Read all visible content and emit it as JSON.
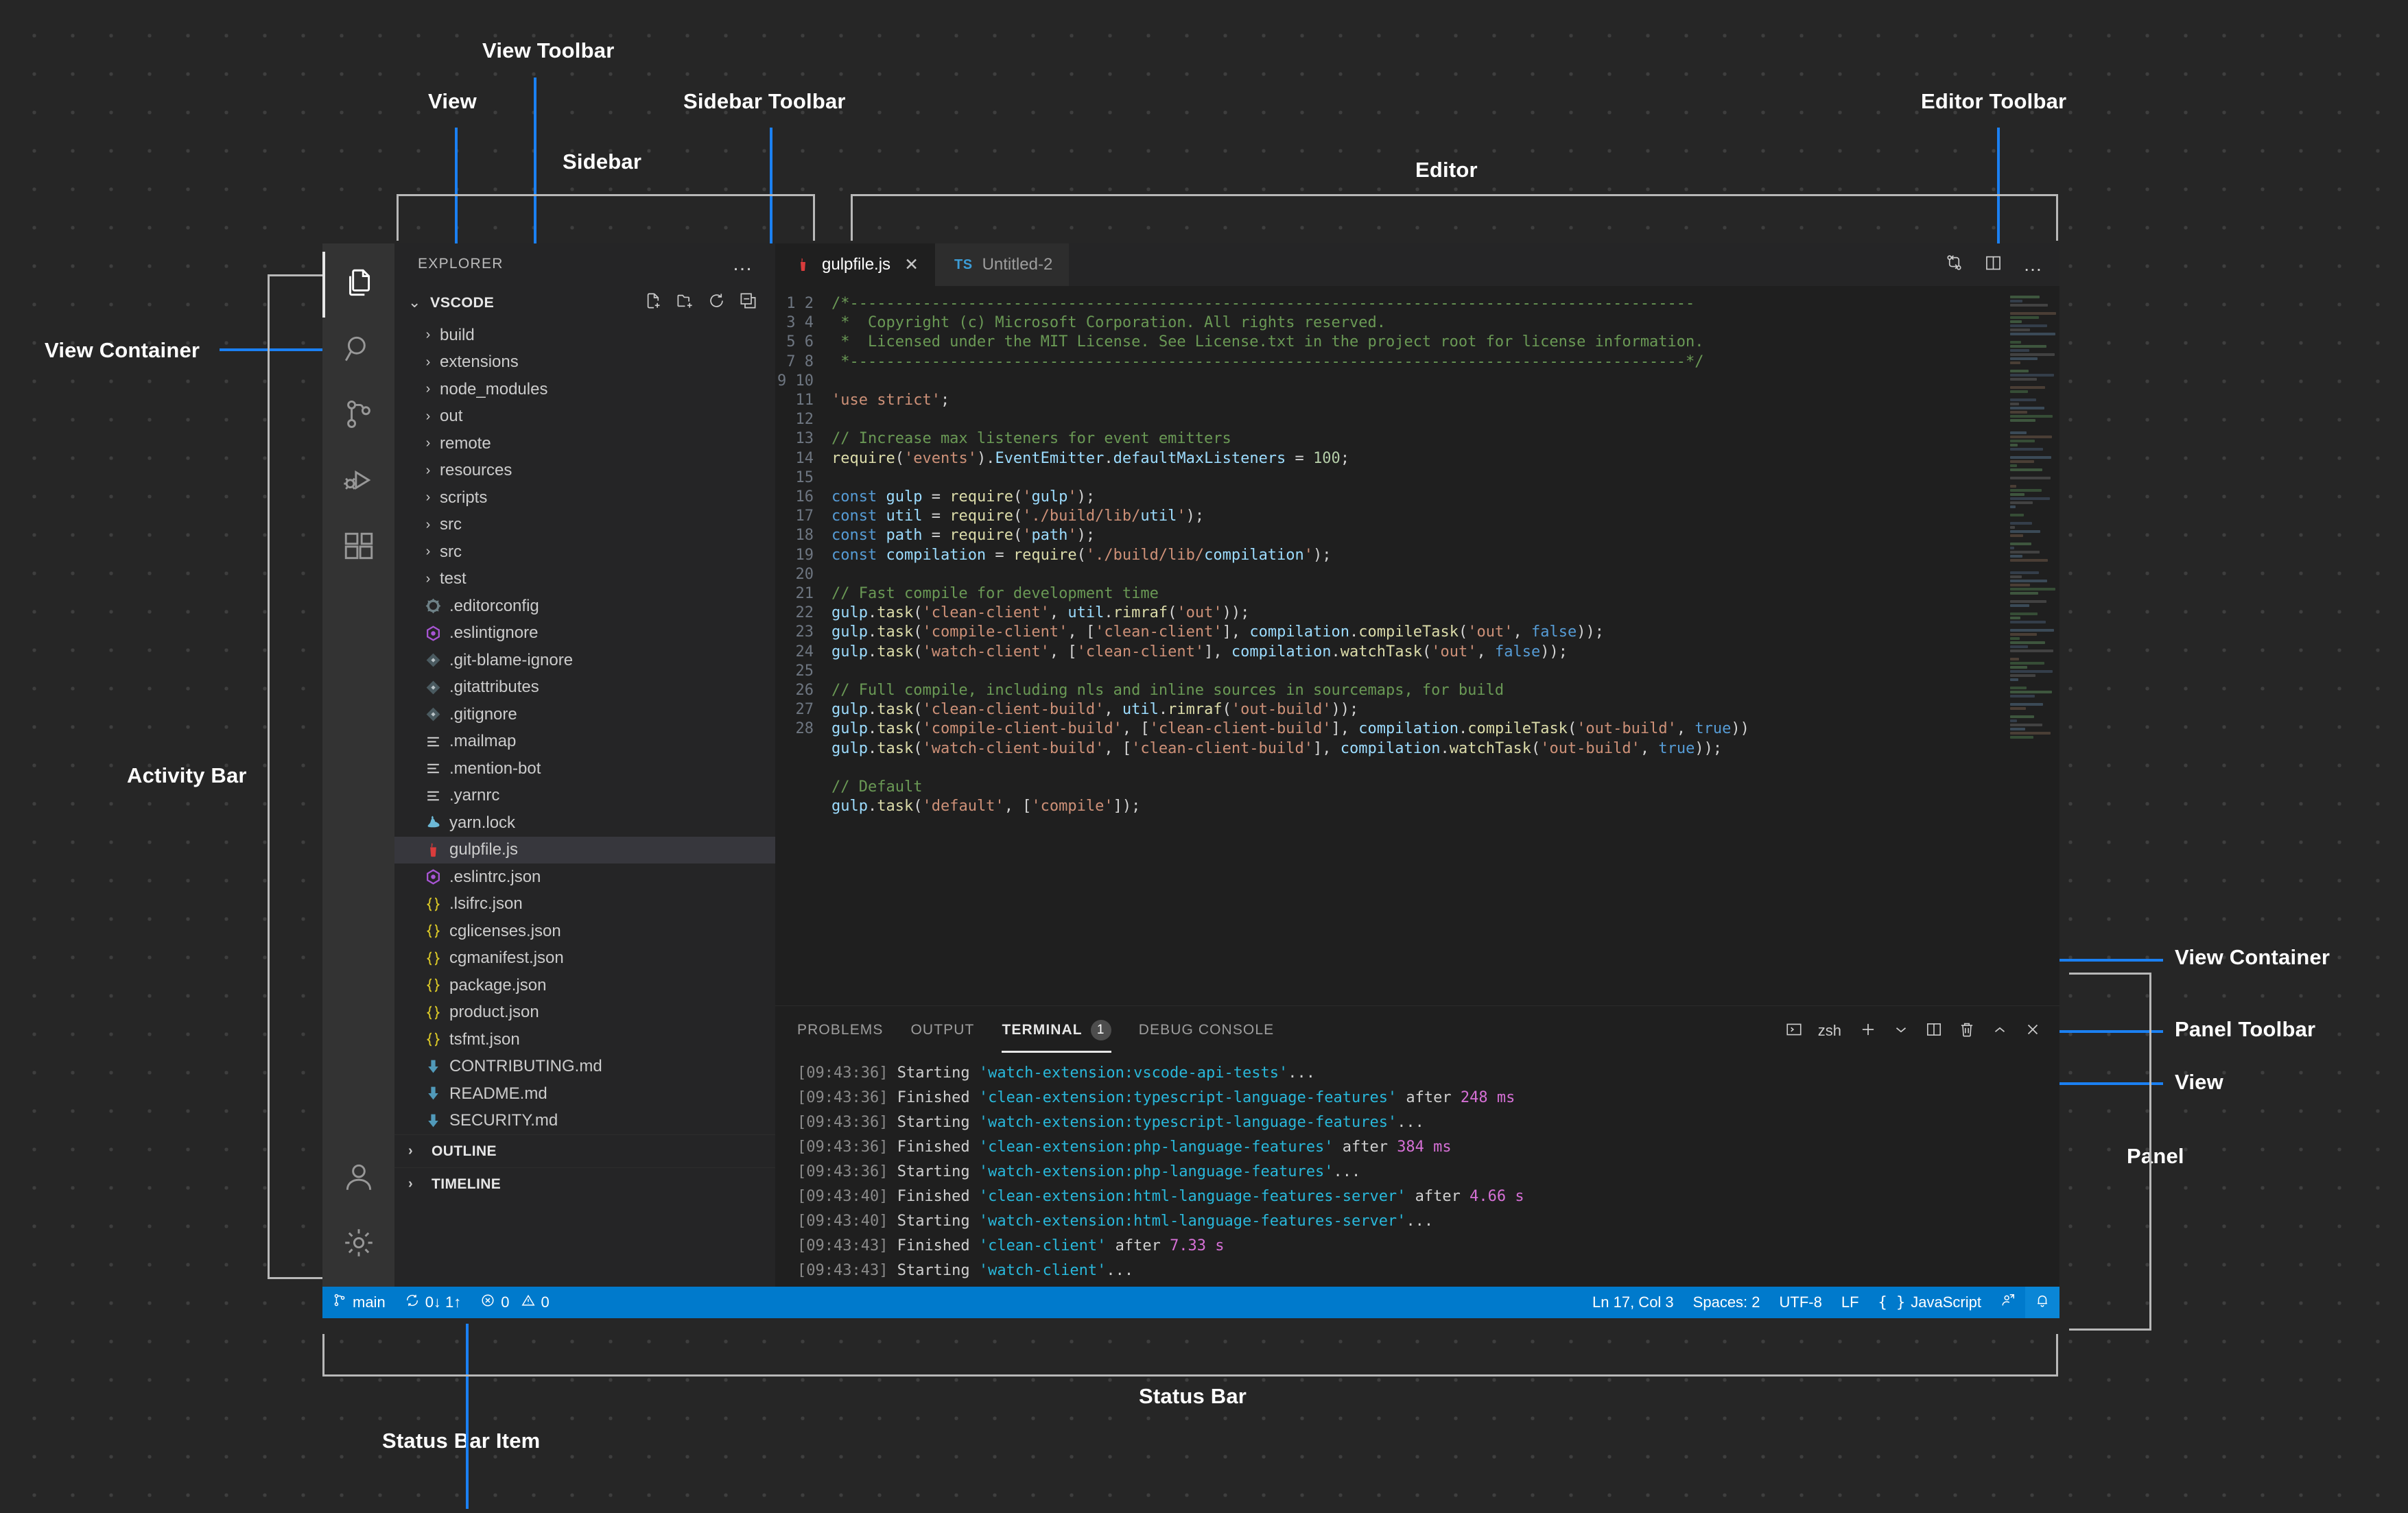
{
  "annotations": [
    {
      "key": "view_toolbar",
      "label": "View Toolbar"
    },
    {
      "key": "view_top",
      "label": "View"
    },
    {
      "key": "sidebar_toolbar",
      "label": "Sidebar Toolbar"
    },
    {
      "key": "sidebar",
      "label": "Sidebar"
    },
    {
      "key": "editor",
      "label": "Editor"
    },
    {
      "key": "editor_toolbar",
      "label": "Editor Toolbar"
    },
    {
      "key": "view_container_left",
      "label": "View Container"
    },
    {
      "key": "activity_bar",
      "label": "Activity Bar"
    },
    {
      "key": "view_container_right",
      "label": "View Container"
    },
    {
      "key": "panel_toolbar",
      "label": "Panel Toolbar"
    },
    {
      "key": "view_right",
      "label": "View"
    },
    {
      "key": "panel",
      "label": "Panel"
    },
    {
      "key": "status_bar",
      "label": "Status Bar"
    },
    {
      "key": "status_bar_item",
      "label": "Status Bar Item"
    }
  ],
  "activity_bar": {
    "items": [
      {
        "icon": "files-icon",
        "label": "Explorer",
        "active": true
      },
      {
        "icon": "search-icon",
        "label": "Search",
        "active": false
      },
      {
        "icon": "source-control-icon",
        "label": "Source Control",
        "active": false
      },
      {
        "icon": "run-debug-icon",
        "label": "Run and Debug",
        "active": false
      },
      {
        "icon": "extensions-icon",
        "label": "Extensions",
        "active": false
      }
    ],
    "bottom": [
      {
        "icon": "account-icon",
        "label": "Accounts"
      },
      {
        "icon": "gear-icon",
        "label": "Manage"
      }
    ]
  },
  "sidebar": {
    "title": "EXPLORER",
    "more_actions": "…",
    "view": {
      "twisty": "⌄",
      "title": "VSCODE",
      "toolbar": [
        {
          "icon": "new-file-icon",
          "label": "New File"
        },
        {
          "icon": "new-folder-icon",
          "label": "New Folder"
        },
        {
          "icon": "refresh-icon",
          "label": "Refresh Explorer"
        },
        {
          "icon": "collapse-all-icon",
          "label": "Collapse Folders in Explorer"
        }
      ]
    },
    "tree": [
      {
        "name": "build",
        "type": "folder",
        "icon": "folder-icon"
      },
      {
        "name": "extensions",
        "type": "folder",
        "icon": "folder-icon"
      },
      {
        "name": "node_modules",
        "type": "folder",
        "icon": "folder-icon"
      },
      {
        "name": "out",
        "type": "folder",
        "icon": "folder-icon"
      },
      {
        "name": "remote",
        "type": "folder",
        "icon": "folder-icon"
      },
      {
        "name": "resources",
        "type": "folder",
        "icon": "folder-icon"
      },
      {
        "name": "scripts",
        "type": "folder",
        "icon": "folder-icon"
      },
      {
        "name": "src",
        "type": "folder",
        "icon": "folder-icon"
      },
      {
        "name": "src",
        "type": "folder",
        "icon": "folder-icon"
      },
      {
        "name": "test",
        "type": "folder",
        "icon": "folder-icon"
      },
      {
        "name": ".editorconfig",
        "type": "file",
        "icon": "gear-file-icon"
      },
      {
        "name": ".eslintignore",
        "type": "file",
        "icon": "eslint-icon"
      },
      {
        "name": ".git-blame-ignore",
        "type": "file",
        "icon": "git-icon"
      },
      {
        "name": ".gitattributes",
        "type": "file",
        "icon": "git-icon"
      },
      {
        "name": ".gitignore",
        "type": "file",
        "icon": "git-icon"
      },
      {
        "name": ".mailmap",
        "type": "file",
        "icon": "text-icon"
      },
      {
        "name": ".mention-bot",
        "type": "file",
        "icon": "text-icon"
      },
      {
        "name": ".yarnrc",
        "type": "file",
        "icon": "text-icon"
      },
      {
        "name": "yarn.lock",
        "type": "file",
        "icon": "yarn-icon"
      },
      {
        "name": "gulpfile.js",
        "type": "file",
        "icon": "gulp-icon",
        "selected": true
      },
      {
        "name": ".eslintrc.json",
        "type": "file",
        "icon": "eslint-icon"
      },
      {
        "name": ".lsifrc.json",
        "type": "file",
        "icon": "json-icon"
      },
      {
        "name": "cglicenses.json",
        "type": "file",
        "icon": "json-icon"
      },
      {
        "name": "cgmanifest.json",
        "type": "file",
        "icon": "json-icon"
      },
      {
        "name": "package.json",
        "type": "file",
        "icon": "json-icon"
      },
      {
        "name": "product.json",
        "type": "file",
        "icon": "json-icon"
      },
      {
        "name": "tsfmt.json",
        "type": "file",
        "icon": "json-icon"
      },
      {
        "name": "CONTRIBUTING.md",
        "type": "file",
        "icon": "markdown-icon"
      },
      {
        "name": "README.md",
        "type": "file",
        "icon": "markdown-icon"
      },
      {
        "name": "SECURITY.md",
        "type": "file",
        "icon": "markdown-icon"
      }
    ],
    "collapsed_sections": [
      {
        "twisty": "›",
        "label": "OUTLINE"
      },
      {
        "twisty": "›",
        "label": "TIMELINE"
      }
    ]
  },
  "editor": {
    "tabs": [
      {
        "label": "gulpfile.js",
        "icon": "gulp-icon",
        "active": true,
        "close": "✕"
      },
      {
        "label": "Untitled-2",
        "icon": "ts-icon",
        "badge": "TS",
        "active": false
      }
    ],
    "toolbar": [
      {
        "icon": "run-task-icon",
        "label": "Run Task"
      },
      {
        "icon": "split-editor-icon",
        "label": "Split Editor Right"
      },
      {
        "icon": "more-actions-icon",
        "label": "More Actions...",
        "glyph": "…"
      }
    ],
    "first_line_number": 1,
    "last_line_number": 28,
    "code_lines": [
      "/*---------------------------------------------------------------------------------------------",
      " *  Copyright (c) Microsoft Corporation. All rights reserved.",
      " *  Licensed under the MIT License. See License.txt in the project root for license information.",
      " *--------------------------------------------------------------------------------------------*/",
      "",
      "'use strict';",
      "",
      "// Increase max listeners for event emitters",
      "require('events').EventEmitter.defaultMaxListeners = 100;",
      "",
      "const gulp = require('gulp');",
      "const util = require('./build/lib/util');",
      "const path = require('path');",
      "const compilation = require('./build/lib/compilation');",
      "",
      "// Fast compile for development time",
      "gulp.task('clean-client', util.rimraf('out'));",
      "gulp.task('compile-client', ['clean-client'], compilation.compileTask('out', false));",
      "gulp.task('watch-client', ['clean-client'], compilation.watchTask('out', false));",
      "",
      "// Full compile, including nls and inline sources in sourcemaps, for build",
      "gulp.task('clean-client-build', util.rimraf('out-build'));",
      "gulp.task('compile-client-build', ['clean-client-build'], compilation.compileTask('out-build', true))",
      "gulp.task('watch-client-build', ['clean-client-build'], compilation.watchTask('out-build', true));",
      "",
      "// Default",
      "gulp.task('default', ['compile']);",
      ""
    ]
  },
  "panel": {
    "tabs": [
      {
        "label": "PROBLEMS",
        "active": false
      },
      {
        "label": "OUTPUT",
        "active": false
      },
      {
        "label": "TERMINAL",
        "active": true,
        "count": "1"
      },
      {
        "label": "DEBUG CONSOLE",
        "active": false
      }
    ],
    "toolbar": {
      "shell_icon": "terminal-icon",
      "shell_name": "zsh",
      "buttons": [
        {
          "icon": "new-terminal-icon",
          "label": "New Terminal",
          "glyph": "+"
        },
        {
          "icon": "chevron-down-icon",
          "label": "Launch Profile",
          "glyph": "⌄"
        },
        {
          "icon": "split-terminal-icon",
          "label": "Split Terminal"
        },
        {
          "icon": "trash-icon",
          "label": "Kill Terminal"
        },
        {
          "icon": "chevron-up-icon",
          "label": "Maximize Panel Size",
          "glyph": "^"
        },
        {
          "icon": "close-icon",
          "label": "Close Panel",
          "glyph": "✕"
        }
      ]
    },
    "terminal_lines": [
      {
        "time": "[09:43:36]",
        "verb": " Starting ",
        "task": "'watch-extension:vscode-api-tests'",
        "tail": "..."
      },
      {
        "time": "[09:43:36]",
        "verb": " Finished ",
        "task": "'clean-extension:typescript-language-features'",
        "tail": " after ",
        "dur": "248 ms"
      },
      {
        "time": "[09:43:36]",
        "verb": " Starting ",
        "task": "'watch-extension:typescript-language-features'",
        "tail": "..."
      },
      {
        "time": "[09:43:36]",
        "verb": " Finished ",
        "task": "'clean-extension:php-language-features'",
        "tail": " after ",
        "dur": "384 ms"
      },
      {
        "time": "[09:43:36]",
        "verb": " Starting ",
        "task": "'watch-extension:php-language-features'",
        "tail": "..."
      },
      {
        "time": "[09:43:40]",
        "verb": " Finished ",
        "task": "'clean-extension:html-language-features-server'",
        "tail": " after ",
        "dur": "4.66 s"
      },
      {
        "time": "[09:43:40]",
        "verb": " Starting ",
        "task": "'watch-extension:html-language-features-server'",
        "tail": "..."
      },
      {
        "time": "[09:43:43]",
        "verb": " Finished ",
        "task": "'clean-client'",
        "tail": " after ",
        "dur": "7.33 s"
      },
      {
        "time": "[09:43:43]",
        "verb": " Starting ",
        "task": "'watch-client'",
        "tail": "..."
      }
    ]
  },
  "status_bar": {
    "left": [
      {
        "icon": "source-control-icon",
        "label": "main",
        "name": "branch-item"
      },
      {
        "icon": "sync-icon",
        "label": "0↓ 1↑",
        "name": "sync-item"
      },
      {
        "icon": "error-warning-icon",
        "label": "0  0",
        "errors": "0",
        "warnings": "0",
        "name": "problems-item"
      }
    ],
    "right": [
      {
        "label": "Ln 17, Col 3",
        "name": "cursor-position-item"
      },
      {
        "label": "Spaces: 2",
        "name": "indentation-item"
      },
      {
        "label": "UTF-8",
        "name": "encoding-item"
      },
      {
        "label": "LF",
        "name": "eol-item"
      },
      {
        "label": "JavaScript",
        "icon": "json-brackets-icon",
        "name": "language-mode-item"
      },
      {
        "icon": "feedback-icon",
        "label": "",
        "name": "feedback-item"
      },
      {
        "icon": "bell-icon",
        "label": "",
        "name": "notifications-item",
        "highlight": true
      }
    ]
  },
  "colors": {
    "accent_blue": "#1b80f2",
    "status_bar_blue": "#007acc",
    "backdrop": "#262626",
    "editor_bg": "#1f1f1f",
    "sidebar_bg": "#252526",
    "activity_bar_bg": "#333333",
    "brace_gray": "#b8b8b8",
    "selection_bg": "#37373d"
  }
}
